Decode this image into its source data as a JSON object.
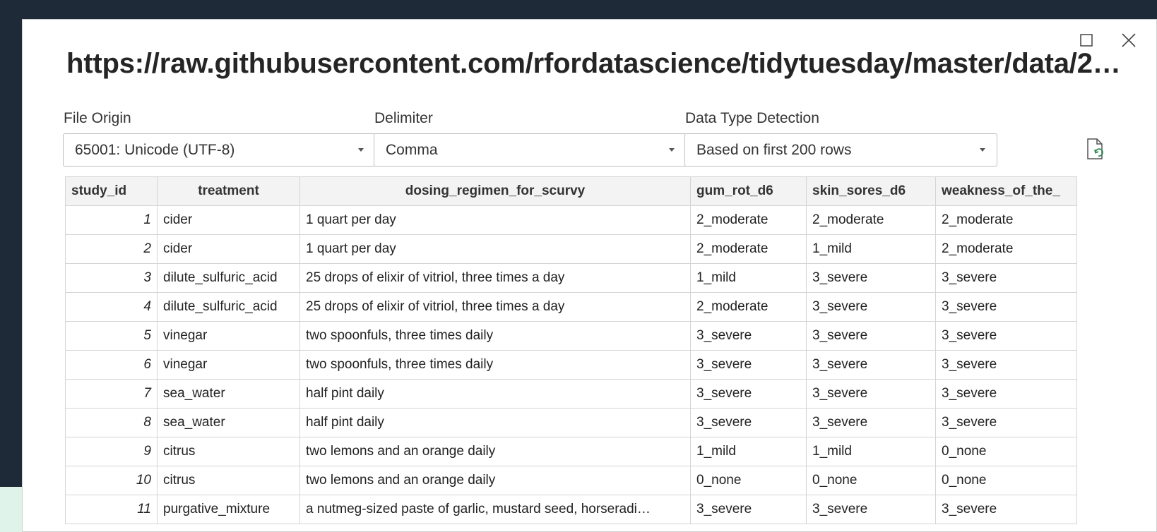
{
  "dialog": {
    "title": "https://raw.githubusercontent.com/rfordatascience/tidytuesday/master/data/2…"
  },
  "options": {
    "file_origin": {
      "label": "File Origin",
      "value": "65001: Unicode (UTF-8)"
    },
    "delimiter": {
      "label": "Delimiter",
      "value": "Comma"
    },
    "data_type_detection": {
      "label": "Data Type Detection",
      "value": "Based on first 200 rows"
    }
  },
  "icons": {
    "maximize": "maximize-icon",
    "close": "close-icon",
    "refresh": "refresh-file-icon"
  },
  "table": {
    "columns": [
      "study_id",
      "treatment",
      "dosing_regimen_for_scurvy",
      "gum_rot_d6",
      "skin_sores_d6",
      "weakness_of_the_"
    ],
    "rows": [
      [
        "1",
        "cider",
        "1 quart per day",
        "2_moderate",
        "2_moderate",
        "2_moderate"
      ],
      [
        "2",
        "cider",
        "1 quart per day",
        "2_moderate",
        "1_mild",
        "2_moderate"
      ],
      [
        "3",
        "dilute_sulfuric_acid",
        "25 drops of elixir of vitriol, three times a day",
        "1_mild",
        "3_severe",
        "3_severe"
      ],
      [
        "4",
        "dilute_sulfuric_acid",
        "25 drops of elixir of vitriol, three times a day",
        "2_moderate",
        "3_severe",
        "3_severe"
      ],
      [
        "5",
        "vinegar",
        "two spoonfuls, three times daily",
        "3_severe",
        "3_severe",
        "3_severe"
      ],
      [
        "6",
        "vinegar",
        "two spoonfuls, three times daily",
        "3_severe",
        "3_severe",
        "3_severe"
      ],
      [
        "7",
        "sea_water",
        "half pint daily",
        "3_severe",
        "3_severe",
        "3_severe"
      ],
      [
        "8",
        "sea_water",
        "half pint daily",
        "3_severe",
        "3_severe",
        "3_severe"
      ],
      [
        "9",
        "citrus",
        "two lemons and an orange daily",
        "1_mild",
        "1_mild",
        "0_none"
      ],
      [
        "10",
        "citrus",
        "two lemons and an orange daily",
        "0_none",
        "0_none",
        "0_none"
      ],
      [
        "11",
        "purgative_mixture",
        "a nutmeg-sized paste of garlic, mustard seed, horseradi…",
        "3_severe",
        "3_severe",
        "3_severe"
      ]
    ]
  }
}
